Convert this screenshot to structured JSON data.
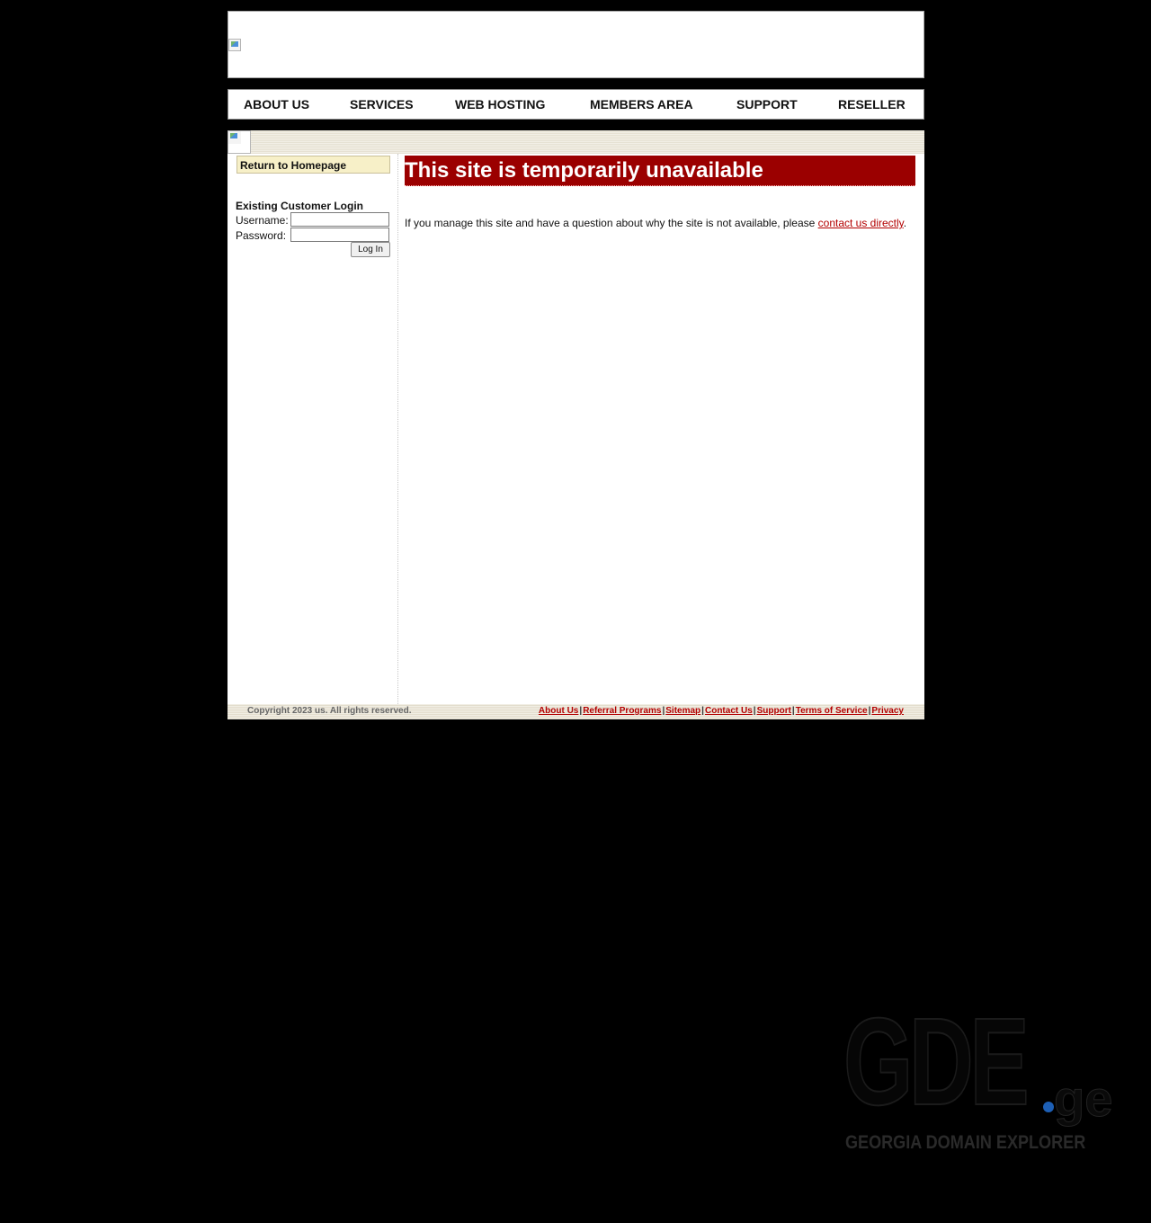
{
  "nav": {
    "items": [
      "ABOUT US",
      "SERVICES",
      "WEB HOSTING",
      "MEMBERS AREA",
      "SUPPORT",
      "RESELLER"
    ]
  },
  "sidebar": {
    "home_link": "Return to Homepage",
    "login_title": "Existing Customer Login",
    "username_label": "Username:",
    "password_label": "Password:",
    "login_button": "Log In"
  },
  "main": {
    "headline": "This site is temporarily unavailable",
    "message_prefix": "If you manage this site and have a question about why the site is not available, please ",
    "message_link": "contact us directly",
    "message_suffix": "."
  },
  "footer": {
    "copyright": "Copyright 2023 us. All rights reserved.",
    "links": [
      "About Us",
      "Referral Programs",
      "Sitemap",
      "Contact Us",
      "Support",
      "Terms of Service",
      "Privacy"
    ],
    "separator": "|"
  },
  "watermark": {
    "logo": "GDE",
    "tld": "ge",
    "tagline": "GEORGIA DOMAIN EXPLORER"
  },
  "colors": {
    "headline_bg": "#9b0000",
    "link": "#b30000",
    "page_bg": "#000000"
  }
}
